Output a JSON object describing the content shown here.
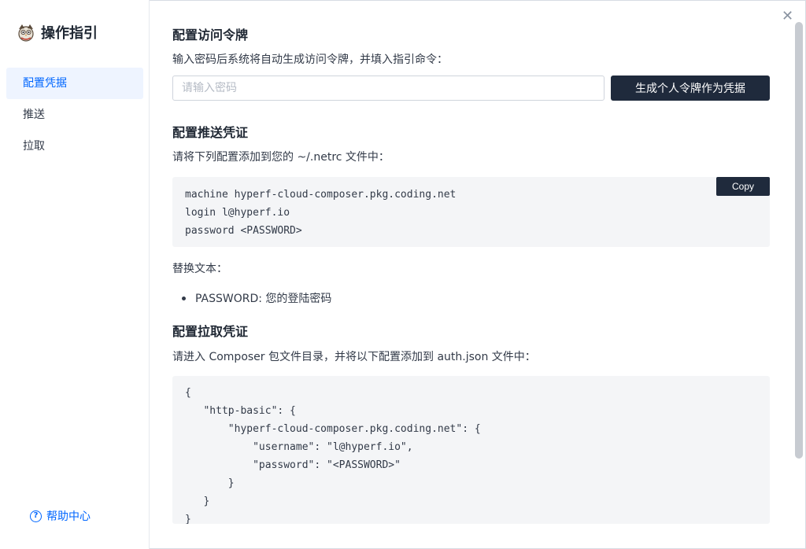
{
  "sidebar": {
    "title": "操作指引",
    "items": [
      {
        "label": "配置凭据",
        "active": true
      },
      {
        "label": "推送",
        "active": false
      },
      {
        "label": "拉取",
        "active": false
      }
    ],
    "help_label": "帮助中心",
    "help_icon": "question-circle-icon",
    "logo_icon": "owl-logo-icon"
  },
  "main": {
    "token": {
      "heading": "配置访问令牌",
      "desc": "输入密码后系统将自动生成访问令牌，并填入指引命令：",
      "input_placeholder": "请输入密码",
      "input_value": "",
      "button_label": "生成个人令牌作为凭据"
    },
    "push": {
      "heading": "配置推送凭证",
      "desc": "请将下列配置添加到您的 ~/.netrc 文件中：",
      "copy_label": "Copy",
      "code": "machine hyperf-cloud-composer.pkg.coding.net\nlogin l@hyperf.io\npassword <PASSWORD>",
      "replace_label": "替换文本：",
      "replace_item": "PASSWORD: 您的登陆密码"
    },
    "pull": {
      "heading": "配置拉取凭证",
      "desc": "请进入 Composer 包文件目录，并将以下配置添加到 auth.json 文件中：",
      "code": "{\n   \"http-basic\": {\n       \"hyperf-cloud-composer.pkg.coding.net\": {\n           \"username\": \"l@hyperf.io\",\n           \"password\": \"<PASSWORD>\"\n       }\n   }\n}"
    }
  },
  "window": {
    "close_icon": "close-icon",
    "close_glyph": "✕"
  },
  "colors": {
    "accent": "#0066ff",
    "button_dark": "#1f2a3c",
    "code_bg": "#f4f5f7",
    "active_bg": "#eef4ff"
  }
}
